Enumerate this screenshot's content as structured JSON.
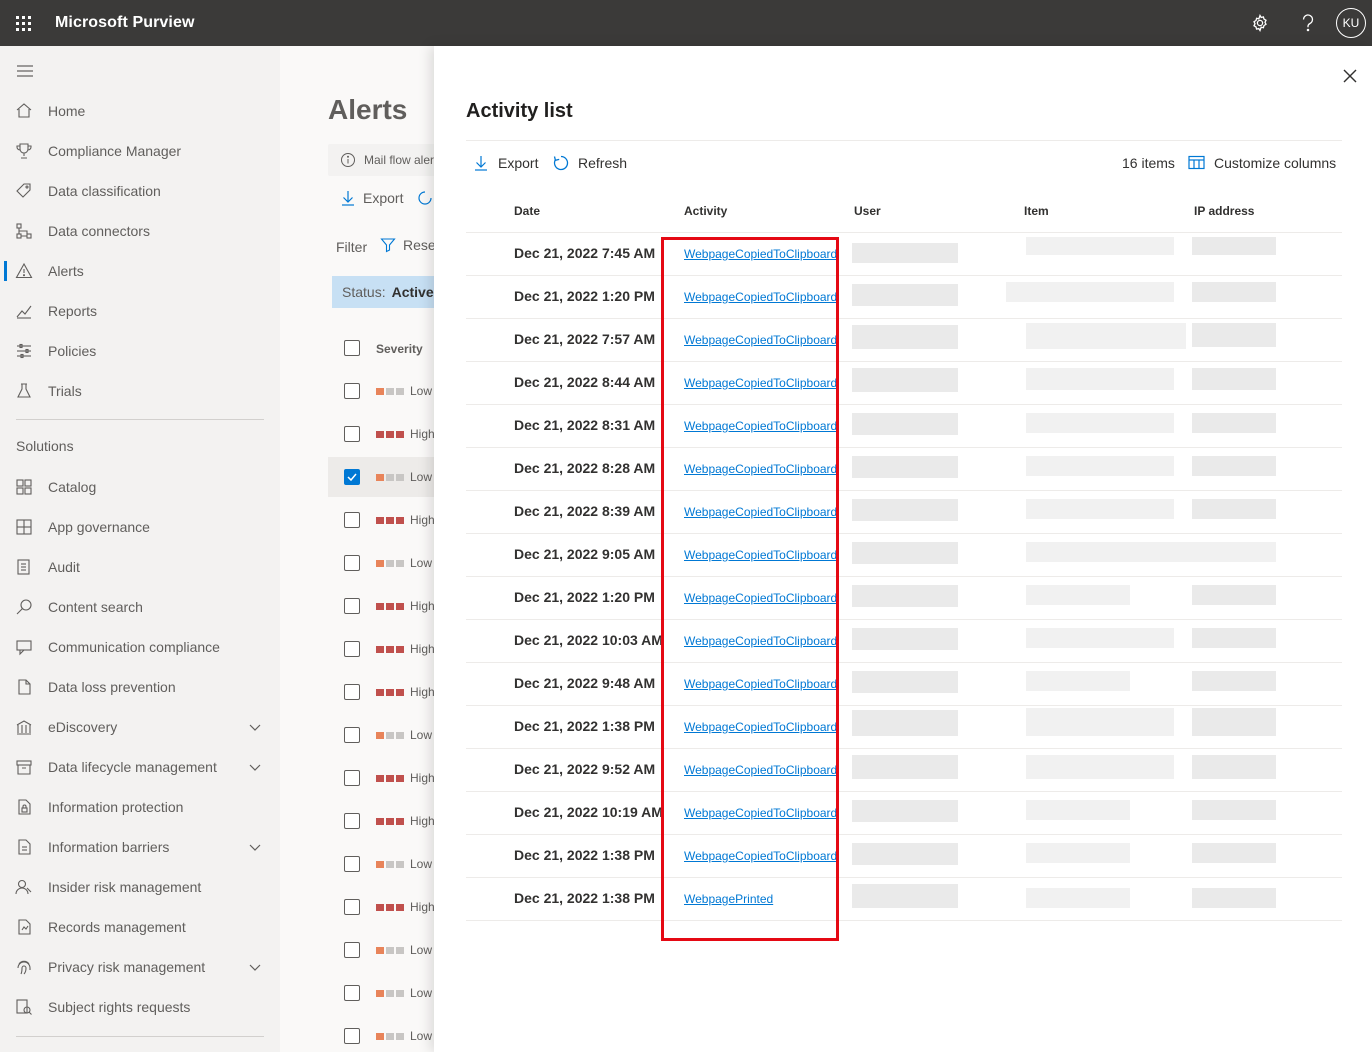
{
  "topbar": {
    "app_title": "Microsoft Purview",
    "icons": [
      "waffle-icon",
      "settings-icon",
      "help-icon"
    ],
    "avatar_initials": "KU"
  },
  "leftnav": {
    "items": [
      {
        "label": "Home",
        "icon": "home-icon"
      },
      {
        "label": "Compliance Manager",
        "icon": "trophy-icon"
      },
      {
        "label": "Data classification",
        "icon": "tag-icon"
      },
      {
        "label": "Data connectors",
        "icon": "connector-icon"
      },
      {
        "label": "Alerts",
        "icon": "warning-icon",
        "active": true
      },
      {
        "label": "Reports",
        "icon": "chart-icon"
      },
      {
        "label": "Policies",
        "icon": "sliders-icon"
      },
      {
        "label": "Trials",
        "icon": "flask-icon"
      }
    ],
    "solutions_heading": "Solutions",
    "solutions": [
      {
        "label": "Catalog",
        "icon": "catalog-icon"
      },
      {
        "label": "App governance",
        "icon": "grid-icon"
      },
      {
        "label": "Audit",
        "icon": "audit-icon"
      },
      {
        "label": "Content search",
        "icon": "search-icon"
      },
      {
        "label": "Communication compliance",
        "icon": "chat-icon"
      },
      {
        "label": "Data loss prevention",
        "icon": "shield-doc-icon"
      },
      {
        "label": "eDiscovery",
        "icon": "building-icon",
        "expandable": true
      },
      {
        "label": "Data lifecycle management",
        "icon": "archive-icon",
        "expandable": true
      },
      {
        "label": "Information protection",
        "icon": "lock-doc-icon"
      },
      {
        "label": "Information barriers",
        "icon": "barrier-icon",
        "expandable": true
      },
      {
        "label": "Insider risk management",
        "icon": "person-icon"
      },
      {
        "label": "Records management",
        "icon": "records-icon"
      },
      {
        "label": "Privacy risk management",
        "icon": "fingerprint-icon",
        "expandable": true
      },
      {
        "label": "Subject rights requests",
        "icon": "request-icon"
      }
    ]
  },
  "alerts_page": {
    "title": "Alerts",
    "info_text": "Mail flow aler",
    "export_label": "Export",
    "filter_label": "Filter",
    "reset_label": "Rese",
    "status_label": "Status:",
    "status_value": "Active,",
    "severity_header": "Severity",
    "rows": [
      {
        "severity": "Low",
        "color": "#e8845a"
      },
      {
        "severity": "High",
        "color": "#c0504d"
      },
      {
        "severity": "Low",
        "color": "#e8845a",
        "checked": true
      },
      {
        "severity": "High",
        "color": "#c0504d"
      },
      {
        "severity": "Low",
        "color": "#e8845a"
      },
      {
        "severity": "High",
        "color": "#c0504d"
      },
      {
        "severity": "High",
        "color": "#c0504d"
      },
      {
        "severity": "High",
        "color": "#c0504d"
      },
      {
        "severity": "Low",
        "color": "#e8845a"
      },
      {
        "severity": "High",
        "color": "#c0504d"
      },
      {
        "severity": "High",
        "color": "#c0504d"
      },
      {
        "severity": "Low",
        "color": "#e8845a"
      },
      {
        "severity": "High",
        "color": "#c0504d"
      },
      {
        "severity": "Low",
        "color": "#e8845a"
      },
      {
        "severity": "Low",
        "color": "#e8845a"
      },
      {
        "severity": "Low",
        "color": "#e8845a"
      }
    ]
  },
  "panel": {
    "title": "Activity list",
    "export_label": "Export",
    "refresh_label": "Refresh",
    "items_count": "16 items",
    "customize_label": "Customize columns",
    "columns": [
      "Date",
      "Activity",
      "User",
      "Item",
      "IP address"
    ],
    "rows": [
      {
        "date": "Dec 21, 2022 7:45 AM",
        "activity": "WebpageCopiedToClipboard"
      },
      {
        "date": "Dec 21, 2022 1:20 PM",
        "activity": "WebpageCopiedToClipboard"
      },
      {
        "date": "Dec 21, 2022 7:57 AM",
        "activity": "WebpageCopiedToClipboard"
      },
      {
        "date": "Dec 21, 2022 8:44 AM",
        "activity": "WebpageCopiedToClipboard"
      },
      {
        "date": "Dec 21, 2022 8:31 AM",
        "activity": "WebpageCopiedToClipboard"
      },
      {
        "date": "Dec 21, 2022 8:28 AM",
        "activity": "WebpageCopiedToClipboard"
      },
      {
        "date": "Dec 21, 2022 8:39 AM",
        "activity": "WebpageCopiedToClipboard"
      },
      {
        "date": "Dec 21, 2022 9:05 AM",
        "activity": "WebpageCopiedToClipboard"
      },
      {
        "date": "Dec 21, 2022 1:20 PM",
        "activity": "WebpageCopiedToClipboard"
      },
      {
        "date": "Dec 21, 2022 10:03 AM",
        "activity": "WebpageCopiedToClipboard"
      },
      {
        "date": "Dec 21, 2022 9:48 AM",
        "activity": "WebpageCopiedToClipboard"
      },
      {
        "date": "Dec 21, 2022 1:38 PM",
        "activity": "WebpageCopiedToClipboard"
      },
      {
        "date": "Dec 21, 2022 9:52 AM",
        "activity": "WebpageCopiedToClipboard"
      },
      {
        "date": "Dec 21, 2022 10:19 AM",
        "activity": "WebpageCopiedToClipboard"
      },
      {
        "date": "Dec 21, 2022 1:38 PM",
        "activity": "WebpageCopiedToClipboard"
      },
      {
        "date": "Dec 21, 2022 1:38 PM",
        "activity": "WebpagePrinted"
      }
    ],
    "highlight_color": "#e50914"
  }
}
